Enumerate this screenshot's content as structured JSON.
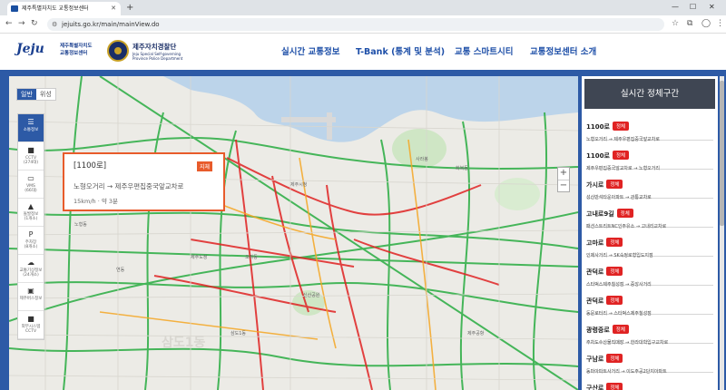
{
  "browser": {
    "tab_title": "제주특별자치도 교통정보센터",
    "url": "jejuits.go.kr/main/mainView.do"
  },
  "header": {
    "logo_text": "Jeju",
    "logo_sub_1": "제주특별자치도",
    "logo_sub_2": "교통정보센터",
    "police_title": "제주자치경찰단",
    "police_sub": "Jeju Special Self-governing Province Police Department",
    "nav": [
      "실시간 교통정보",
      "T-Bank (통계 및 분석)",
      "교통 스마트시티",
      "교통정보센터 소개"
    ]
  },
  "map": {
    "map_types": [
      "일반",
      "위성"
    ],
    "side_menu": [
      {
        "label": "소통정보",
        "count": "",
        "icon": "layers-icon"
      },
      {
        "label": "CCTV",
        "count": "(274대)",
        "icon": "cctv-icon"
      },
      {
        "label": "VMS",
        "count": "(66대)",
        "icon": "vms-icon"
      },
      {
        "label": "돌발정보",
        "count": "(1개소)",
        "icon": "warning-icon"
      },
      {
        "label": "주차장",
        "count": "(8개소)",
        "icon": "parking-icon"
      },
      {
        "label": "교통기상정보",
        "count": "(24개소)",
        "icon": "weather-icon"
      },
      {
        "label": "제주버스정보",
        "count": "",
        "icon": "bus-icon"
      },
      {
        "label": "외부시스템",
        "count": "CCTV",
        "icon": "external-cctv-icon"
      }
    ],
    "popup": {
      "title": "[1100로]",
      "badge": "지체",
      "route": "노형오거리 → 제주우편집중국앞교차로",
      "speed": "15km/h  ·  약 3분"
    },
    "labels": [
      "사라봉",
      "화북동",
      "제주시청",
      "제주도청",
      "오라동",
      "연동",
      "노형동",
      "삼도1동",
      "신산공원",
      "제주공항"
    ],
    "districts": [
      "삼도1동"
    ]
  },
  "panel": {
    "title": "실시간 정체구간",
    "roads": [
      {
        "name": "1100로",
        "status": "정체",
        "route": "노형오거리 → 제주우편집중국앞교차로"
      },
      {
        "name": "1100로",
        "status": "정체",
        "route": "제주우편집중국앞교차로 → 노형오거리"
      },
      {
        "name": "가시로",
        "status": "정체",
        "route": "성산반석타운아파트 → 관통교차로"
      },
      {
        "name": "고내로9길",
        "status": "정체",
        "route": "패션스트리트NC인주유소 → 고내리교차로"
      },
      {
        "name": "고마로",
        "status": "정체",
        "route": "인제사거리 → SK숙정로형입도지점"
      },
      {
        "name": "관덕로",
        "status": "정체",
        "route": "스타벅스제주칠성점 → 중앙사거리"
      },
      {
        "name": "관덕로",
        "status": "정체",
        "route": "동문로터리 → 스타벅스제주칠성점"
      },
      {
        "name": "광령중로",
        "status": "정체",
        "route": "주차도수산물직매장 → 한라대학입구교차로"
      },
      {
        "name": "구남로",
        "status": "정체",
        "route": "동마아파트사거리 → 이도주공2단지아파트"
      },
      {
        "name": "구산로",
        "status": "정체",
        "route": ""
      }
    ]
  },
  "colors": {
    "brand": "#2d5aa6",
    "congested": "#e02323",
    "delay": "#e85b2b",
    "smooth": "#33b04a"
  }
}
